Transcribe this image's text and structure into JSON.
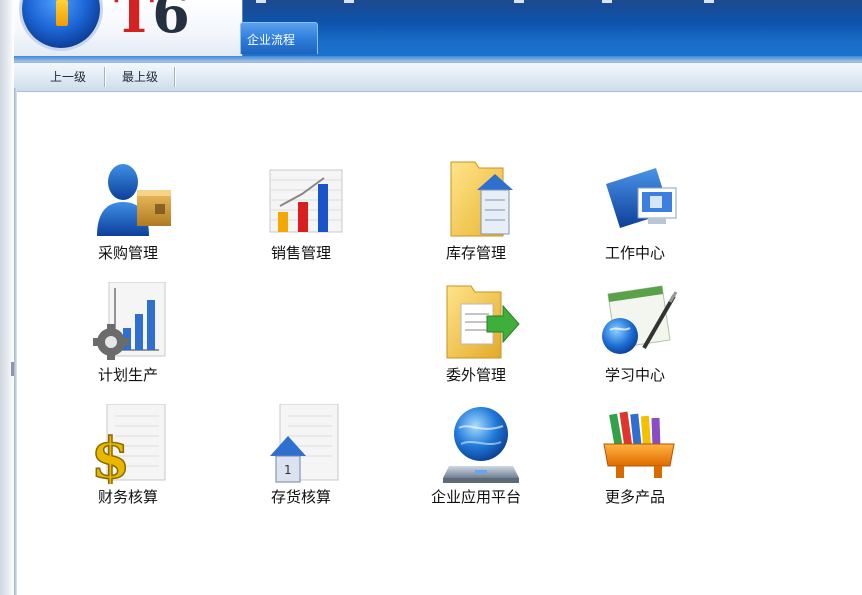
{
  "header": {
    "logo_text_t": "T",
    "logo_text_num": "6",
    "tab_label": "企业流程"
  },
  "navbar": {
    "up_one_level": "上一级",
    "top_level": "最上级"
  },
  "modules": [
    {
      "label": "采购管理",
      "icon": "purchasing-person-box-icon"
    },
    {
      "label": "销售管理",
      "icon": "sales-bar-chart-icon"
    },
    {
      "label": "库存管理",
      "icon": "inventory-folder-house-icon"
    },
    {
      "label": "工作中心",
      "icon": "work-center-monitor-icon"
    },
    {
      "label": "计划生产",
      "icon": "production-plan-chart-gear-icon"
    },
    {
      "label": "委外管理",
      "icon": "outsourcing-folder-arrow-icon"
    },
    {
      "label": "学习中心",
      "icon": "learning-center-globe-pen-icon"
    },
    {
      "label": "财务核算",
      "icon": "finance-dollar-document-icon"
    },
    {
      "label": "存货核算",
      "icon": "stock-accounting-house-document-icon"
    },
    {
      "label": "企业应用平台",
      "icon": "enterprise-platform-globe-icon"
    },
    {
      "label": "更多产品",
      "icon": "more-products-books-icon"
    }
  ],
  "colors": {
    "header_blue": "#0f56b0",
    "logo_red": "#d42222",
    "nav_bar": "#dfe9f4"
  }
}
